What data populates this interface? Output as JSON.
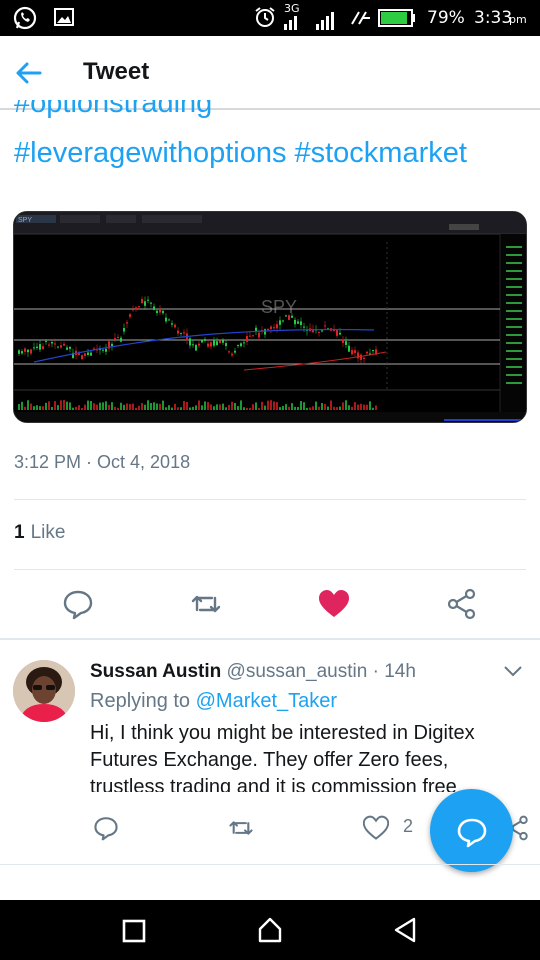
{
  "status_bar": {
    "battery": "79%",
    "time": "3:33",
    "time_suffix": "pm",
    "network": "3G"
  },
  "header": {
    "title": "Tweet"
  },
  "tweet": {
    "partial_hashtag": "#optionstrading",
    "hashtags": [
      "#leveragewithoptions",
      "#stockmarket"
    ],
    "timestamp": "3:12 PM · Oct 4, 2018",
    "like_count": "1",
    "like_label": "Like",
    "chart_image": {
      "symbol": "SPY",
      "watermark": "SPY"
    }
  },
  "reply": {
    "name": "Sussan Austin",
    "handle": "@sussan_austin",
    "time": "· 14h",
    "replying_prefix": "Replying to",
    "replying_mention": "@Market_Taker",
    "text": "Hi, I think you might be interested in Digitex Futures Exchange. They offer Zero fees, trustless trading and it is commission free",
    "like_count": "2"
  },
  "colors": {
    "accent": "#1da1f2",
    "like_red": "#e0245e",
    "muted": "#657786"
  },
  "icons": {
    "back": "arrow-left-icon",
    "reply": "comment-icon",
    "retweet": "retweet-icon",
    "like": "heart-icon",
    "share": "share-icon",
    "compose": "compose-reply-icon"
  }
}
